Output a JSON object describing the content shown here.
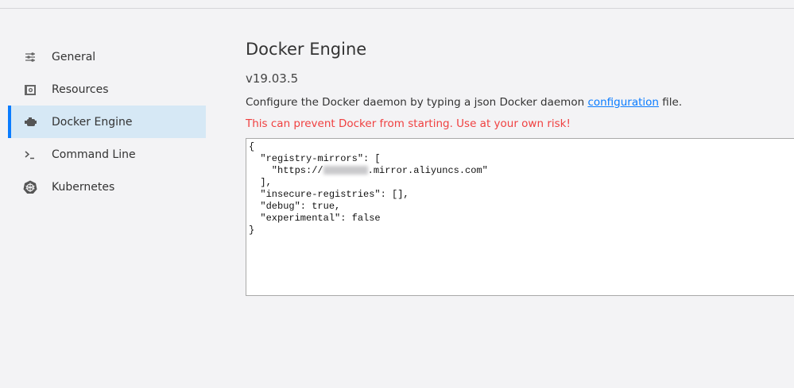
{
  "sidebar": {
    "items": [
      {
        "label": "General",
        "icon": "sliders-icon"
      },
      {
        "label": "Resources",
        "icon": "resources-icon"
      },
      {
        "label": "Docker Engine",
        "icon": "engine-icon",
        "active": true
      },
      {
        "label": "Command Line",
        "icon": "terminal-icon"
      },
      {
        "label": "Kubernetes",
        "icon": "kubernetes-icon"
      }
    ]
  },
  "main": {
    "title": "Docker Engine",
    "version": "v19.03.5",
    "description_prefix": "Configure the Docker daemon by typing a json Docker daemon ",
    "description_link": "configuration",
    "description_suffix": " file.",
    "warning": "This can prevent Docker from starting. Use at your own risk!",
    "warning_color": "#f04040",
    "accent_color": "#0a7cff"
  },
  "editor": {
    "line1": "{",
    "line2": "  \"registry-mirrors\": [",
    "line3_prefix": "    \"https://",
    "line3_suffix": ".mirror.aliyuncs.com\"",
    "line4": "  ],",
    "line5": "  \"insecure-registries\": [],",
    "line6": "  \"debug\": true,",
    "line7": "  \"experimental\": false",
    "line8": "}"
  }
}
